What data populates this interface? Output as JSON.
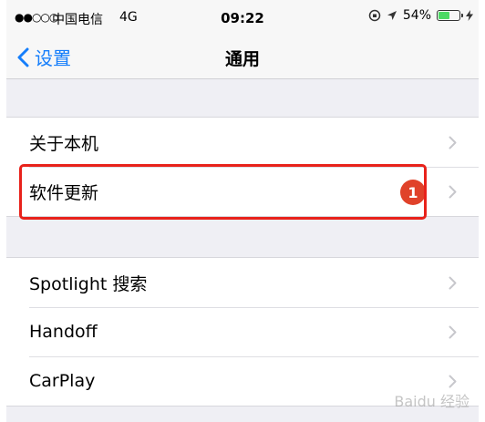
{
  "status_bar": {
    "signal": "●●○○○",
    "carrier": "中国电信",
    "network": "4G",
    "time": "09:22",
    "battery_text": "54%",
    "battery_level": 0.54,
    "battery_color": "#4cd964"
  },
  "nav": {
    "back_label": "设置",
    "title": "通用",
    "accent_color": "#157efb"
  },
  "groups": [
    {
      "items": [
        {
          "label": "关于本机"
        },
        {
          "label": "软件更新",
          "badge": "1"
        }
      ]
    },
    {
      "items": [
        {
          "label": "Spotlight 搜索"
        },
        {
          "label": "Handoff"
        },
        {
          "label": "CarPlay"
        }
      ]
    }
  ],
  "annotation": {
    "color": "#e8221b"
  },
  "watermark": "Baidu 经验"
}
